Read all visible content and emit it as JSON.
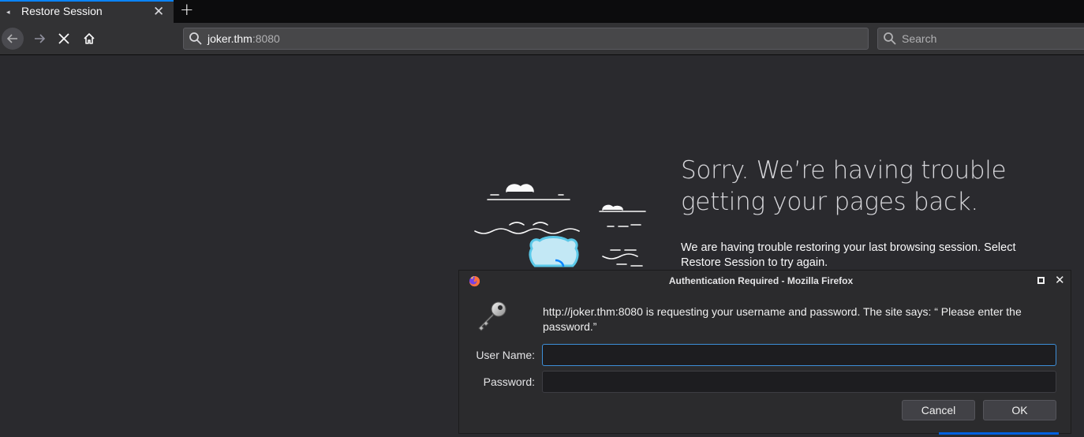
{
  "tab": {
    "title": "Restore Session",
    "close_label": "✕",
    "new_tab_label": "+"
  },
  "navbar": {
    "url_host": "joker.thm",
    "url_port": ":8080",
    "search_placeholder": "Search"
  },
  "page": {
    "headline": "Sorry. We’re having trouble getting your pages back.",
    "description": "We are having trouble restoring your last browsing session. Select Restore Session to try again."
  },
  "dialog": {
    "title": "Authentication Required - Mozilla Firefox",
    "message": "http://joker.thm:8080 is requesting your username and password. The site says: “ Please enter the password.”",
    "username_label": "User Name:",
    "password_label": "Password:",
    "username_value": "",
    "password_value": "",
    "cancel_label": "Cancel",
    "ok_label": "OK"
  },
  "colors": {
    "accent": "#0a84ff",
    "focus_border": "#3d8fd8",
    "page_bg": "#2a2a2e"
  },
  "icons": [
    "back-arrow-icon",
    "forward-arrow-icon",
    "stop-icon",
    "home-icon",
    "search-icon",
    "firefox-icon",
    "key-icon",
    "maximize-icon",
    "close-icon"
  ]
}
